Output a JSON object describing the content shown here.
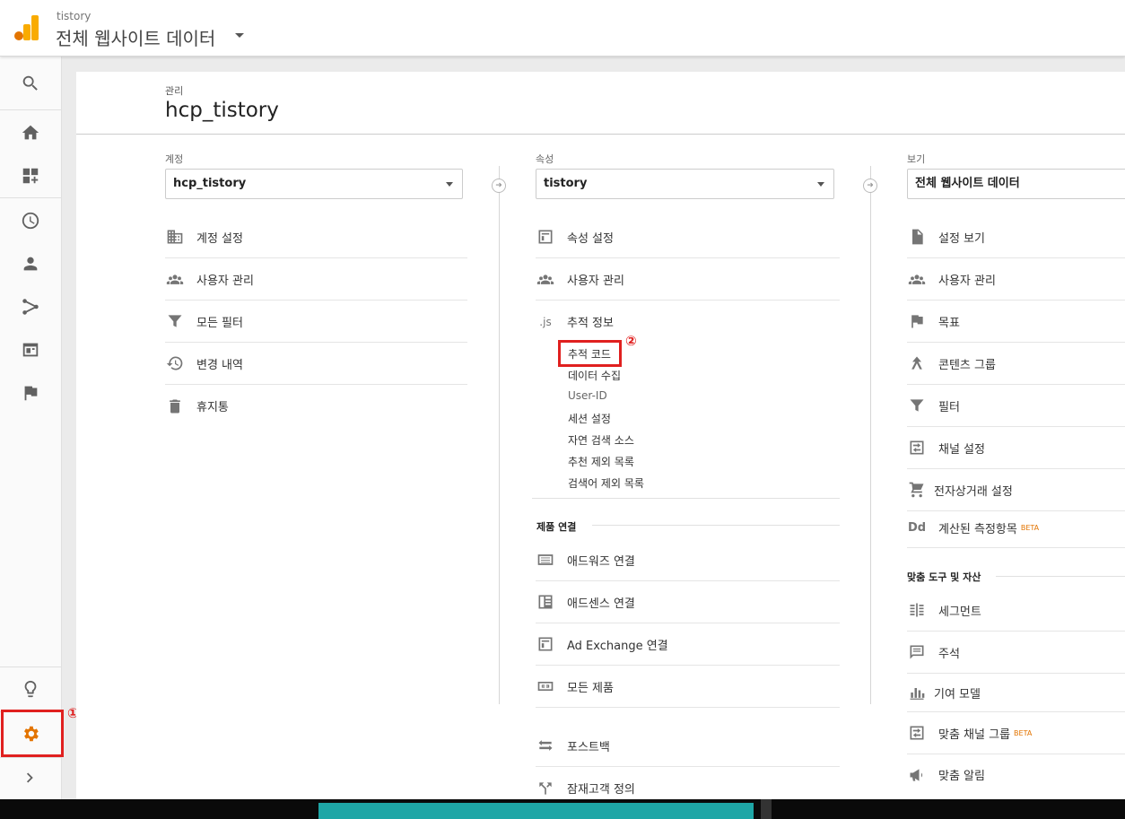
{
  "header": {
    "account": "tistory",
    "view": "전체 웹사이트 데이터"
  },
  "admin": {
    "crumb": "관리",
    "title": "hcp_tistory"
  },
  "account_col": {
    "label": "계정",
    "selected": "hcp_tistory",
    "items": [
      "계정 설정",
      "사용자 관리",
      "모든 필터",
      "변경 내역",
      "휴지통"
    ]
  },
  "property_col": {
    "label": "속성",
    "selected": "tistory",
    "items": [
      "속성 설정",
      "사용자 관리",
      "추적 정보"
    ],
    "tracking_icon": ".js",
    "tracking_sub": [
      "추적 코드",
      "데이터 수집",
      "User-ID",
      "세션 설정",
      "자연 검색 소스",
      "추천 제외 목록",
      "검색어 제외 목록"
    ],
    "product_section": "제품 연결",
    "product_items": [
      "애드워즈 연결",
      "애드센스 연결",
      "Ad Exchange 연결",
      "모든 제품"
    ],
    "extra_items": [
      "포스트백",
      "잠재고객 정의"
    ]
  },
  "view_col": {
    "label": "보기",
    "selected": "전체 웹사이트 데이터",
    "items": [
      "설정 보기",
      "사용자 관리",
      "목표",
      "콘텐츠 그룹",
      "필터",
      "채널 설정",
      "전자상거래 설정",
      "계산된 측정항목"
    ],
    "dd_icon": "Dd",
    "beta": "BETA",
    "tools_section": "맞춤 도구 및 자산",
    "tools_items": [
      "세그먼트",
      "주석",
      "기여 모델",
      "맞춤 채널 그룹",
      "맞춤 알림"
    ]
  },
  "annotations": {
    "one": "①",
    "two": "②"
  },
  "colors": {
    "highlight": "#e0201f",
    "accent": "#e37400",
    "settings": "#e37400"
  }
}
